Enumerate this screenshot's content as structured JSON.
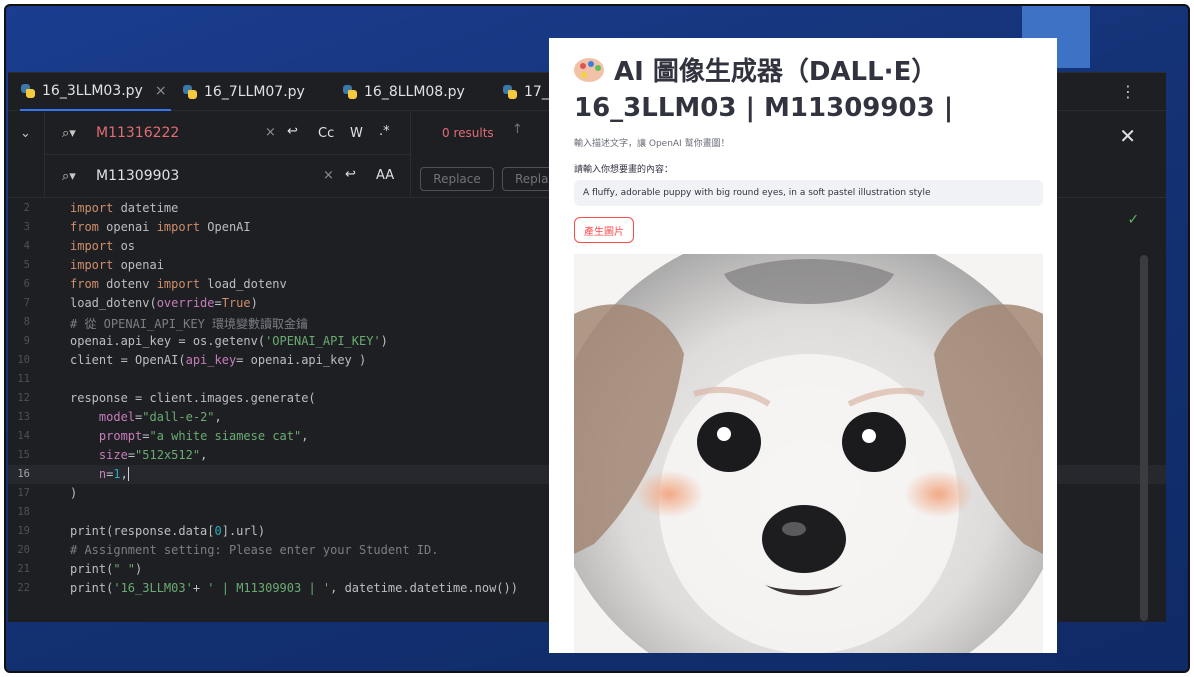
{
  "tabs": [
    {
      "label": "16_3LLM03.py",
      "active": true,
      "closable": true
    },
    {
      "label": "16_7LLM07.py"
    },
    {
      "label": "16_8LLM08.py"
    },
    {
      "label": "17_"
    }
  ],
  "search": {
    "find_value": "M11316222",
    "replace_value": "M11309903",
    "options": [
      "Cc",
      "W",
      ".*"
    ],
    "results": "0 results",
    "replace_label": "Replace",
    "replace_all_label": "Repla"
  },
  "code": {
    "line_numbers": [
      "2",
      "3",
      "4",
      "5",
      "6",
      "7",
      "8",
      "9",
      "10",
      "11",
      "12",
      "13",
      "14",
      "15",
      "16",
      "17",
      "18",
      "19",
      "20",
      "21",
      "22"
    ],
    "current_line": "16"
  },
  "app": {
    "title": "AI 圖像生成器（DALL·E）",
    "title_line2": "16_3LLM03 | M11309903 |",
    "subtitle": "輸入描述文字，讓 OpenAI 幫你畫圖！",
    "input_label": "請輸入你想要畫的內容：",
    "input_value": "A fluffy, adorable puppy with big round eyes, in a soft pastel illustration style",
    "button_label": "產生圖片",
    "image_subject": "puppy-illustration"
  },
  "icons": [
    "python-file-icon",
    "close-icon",
    "kebab-menu-icon",
    "search-icon",
    "regex-icon",
    "arrow-up-icon",
    "check-icon",
    "palette-icon"
  ],
  "colors": {
    "accent": "#3574f0",
    "streamlit_red": "#ff4b4b",
    "search_miss": "#e06c75"
  }
}
